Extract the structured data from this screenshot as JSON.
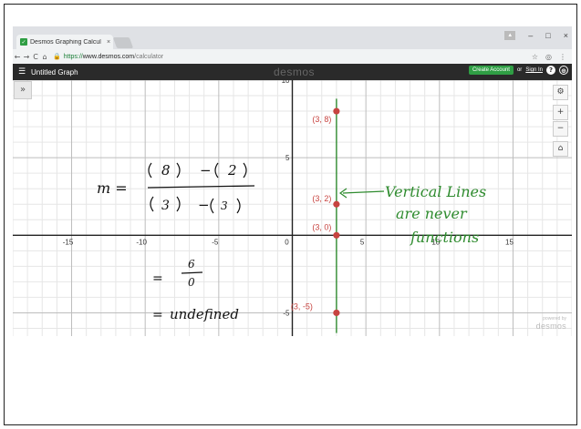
{
  "browser": {
    "tab_title": "Desmos Graphing Calcul",
    "tab_close": "×",
    "favicon_glyph": "✓",
    "window_controls": {
      "user": "▲",
      "minimize": "–",
      "maximize": "□",
      "close": "×"
    },
    "nav": {
      "back": "←",
      "forward": "→",
      "reload": "C",
      "home": "⌂"
    },
    "url_scheme": "https://",
    "url_host": "www.desmos.com",
    "url_path": "/calculator",
    "url_right_icons": {
      "star": "☆",
      "ext": "◎",
      "menu": "⋮"
    }
  },
  "header": {
    "menu_icon": "☰",
    "graph_title": "Untitled Graph",
    "brand": "desmos",
    "create_account_label": "Create Account",
    "or_text": "or",
    "sign_in_label": "Sign In",
    "help_icon": "?",
    "globe_icon": "⊕"
  },
  "graph": {
    "expand_icon": "»",
    "tools": {
      "wrench": "🔧",
      "zoom_in": "+",
      "zoom_out": "−",
      "home": "⌂"
    },
    "powered_by": "powered by",
    "powered_brand": "desmos",
    "colors": {
      "line": "#2e8b2e",
      "point": "#c74440",
      "annotation": "#2e8b2e",
      "ink": "#111111"
    }
  },
  "chart_data": {
    "type": "scatter",
    "xlim": [
      -19,
      19
    ],
    "ylim": [
      -6.5,
      10
    ],
    "grid": true,
    "x_ticks": [
      -15,
      -10,
      -5,
      0,
      5,
      10,
      15
    ],
    "y_ticks": [
      -5,
      5,
      10
    ],
    "series": [
      {
        "points": [
          {
            "x": 3,
            "y": 8
          },
          {
            "x": 3,
            "y": 2
          },
          {
            "x": 3,
            "y": 0
          },
          {
            "x": 3,
            "y": -5
          }
        ]
      }
    ],
    "point_labels": [
      "(3, 8)",
      "(3, 2)",
      "(3, 0)",
      "(3, -5)"
    ],
    "vertical_line_x": 3,
    "annotations": {
      "slope_lhs": "m =",
      "numerator_a": "8",
      "numerator_b": "2",
      "denominator_a": "3",
      "denominator_b": "3",
      "minus": "−",
      "result_eq": "=",
      "result_num": "6",
      "result_den": "0",
      "undefined_eq": "=",
      "undefined_text": "undefined",
      "note_line1": "Vertical Lines",
      "note_line2": "are never",
      "note_line3": "functions"
    }
  }
}
